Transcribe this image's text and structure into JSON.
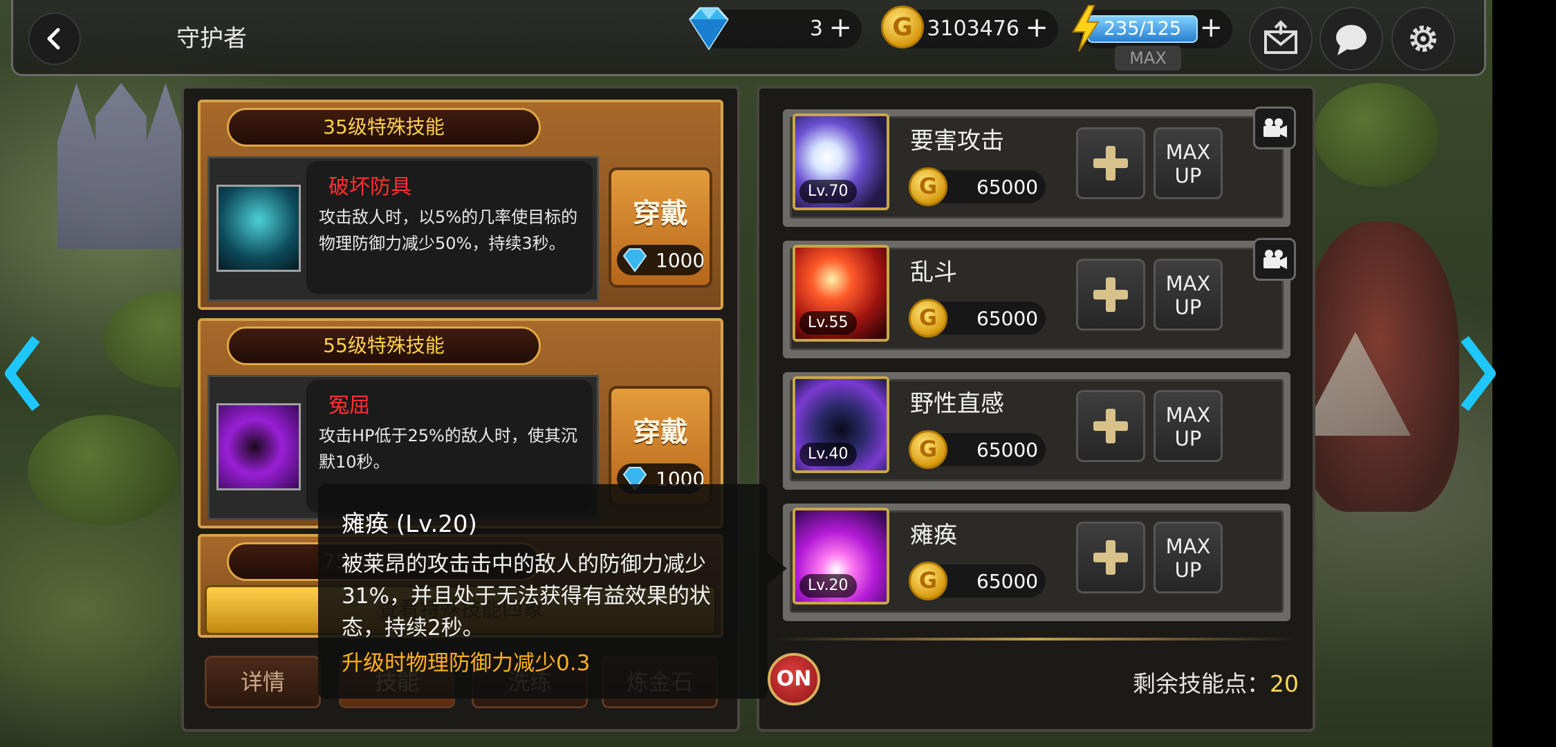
{
  "header": {
    "title": "守护者",
    "gems": "3",
    "gold": "3103476",
    "energy": "235/125",
    "energy_max_label": "MAX"
  },
  "left_panel": {
    "cards": [
      {
        "banner": "35级特殊技能",
        "skill_name": "破坏防具",
        "description": "攻击敌人时，以5%的几率使目标的物理防御力减少50%，持续3秒。",
        "equip_label": "穿戴",
        "cost": "1000"
      },
      {
        "banner": "55级特殊技能",
        "skill_name": "冤屈",
        "description": "攻击HP低于25%的敌人时，使其沉默10秒。",
        "equip_label": "穿戴",
        "cost": "1000"
      },
      {
        "banner": "75级特殊技能"
      }
    ],
    "view_all_label": "查看特殊技能四象",
    "tabs": [
      "详情",
      "技能",
      "洗练",
      "炼金石"
    ],
    "active_tab": 1
  },
  "tooltip": {
    "title": "瘫痪 (Lv.20)",
    "description": "被莱昂的攻击击中的敌人的防御力减少31%，并且处于无法获得有益效果的状态，持续2秒。",
    "bonus": "升级时物理防御力减少0.3"
  },
  "right_panel": {
    "skills": [
      {
        "name": "要害攻击",
        "level": "Lv.70",
        "price": "65000",
        "plus_label": "+",
        "max_up_label_1": "MAX",
        "max_up_label_2": "UP",
        "has_video": true
      },
      {
        "name": "乱斗",
        "level": "Lv.55",
        "price": "65000",
        "plus_label": "+",
        "max_up_label_1": "MAX",
        "max_up_label_2": "UP",
        "has_video": true
      },
      {
        "name": "野性直感",
        "level": "Lv.40",
        "price": "65000",
        "plus_label": "+",
        "max_up_label_1": "MAX",
        "max_up_label_2": "UP",
        "has_video": false
      },
      {
        "name": "瘫痪",
        "level": "Lv.20",
        "price": "65000",
        "plus_label": "+",
        "max_up_label_1": "MAX",
        "max_up_label_2": "UP",
        "has_video": false
      }
    ],
    "auto_toggle_label": "ON",
    "remaining_label": "剩余技能点：",
    "remaining_points": "20"
  },
  "colors": {
    "accent_gold": "#ffd24a",
    "skill_name_red": "#ff3030",
    "bonus_orange": "#ffb21a",
    "energy_blue": "#2a7fd0"
  },
  "icons": {
    "back": "back-arrow-icon",
    "gem": "diamond-icon",
    "gold": "gold-coin-icon",
    "energy": "lightning-icon",
    "mail": "mail-icon",
    "chat": "chat-bubble-icon",
    "settings": "gear-icon",
    "video": "video-camera-icon",
    "plus": "plus-icon",
    "nav_left": "chevron-left-icon",
    "nav_right": "chevron-right-icon"
  }
}
